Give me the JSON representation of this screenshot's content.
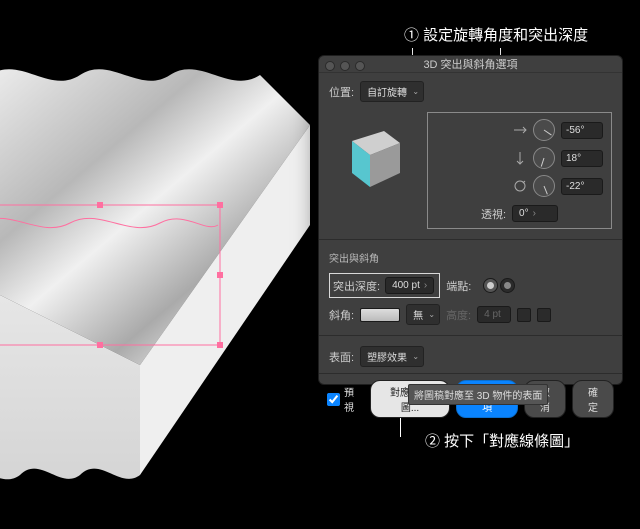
{
  "annotations": {
    "a1": "① 設定旋轉角度和突出深度",
    "a2": "② 按下「對應線條圖」"
  },
  "dialog": {
    "title": "3D 突出與斜角選項",
    "position_label": "位置:",
    "position_value": "自訂旋轉",
    "angles": {
      "x": "-56°",
      "y": "18°",
      "z": "-22°"
    },
    "perspective_label": "透視:",
    "perspective_value": "0°",
    "section_extrude": "突出與斜角",
    "extrude_label": "突出深度:",
    "extrude_value": "400 pt",
    "cap_label": "端點:",
    "bevel_label": "斜角:",
    "bevel_value": "無",
    "height_label": "高度:",
    "height_value": "4 pt",
    "surface_label": "表面:",
    "surface_value": "塑膠效果",
    "preview_label": "預視",
    "map_art": "對應線條圖...",
    "more_options": "更多選項",
    "cancel": "取消",
    "ok": "確定",
    "tooltip": "將圖稿對應至 3D 物件的表面"
  }
}
